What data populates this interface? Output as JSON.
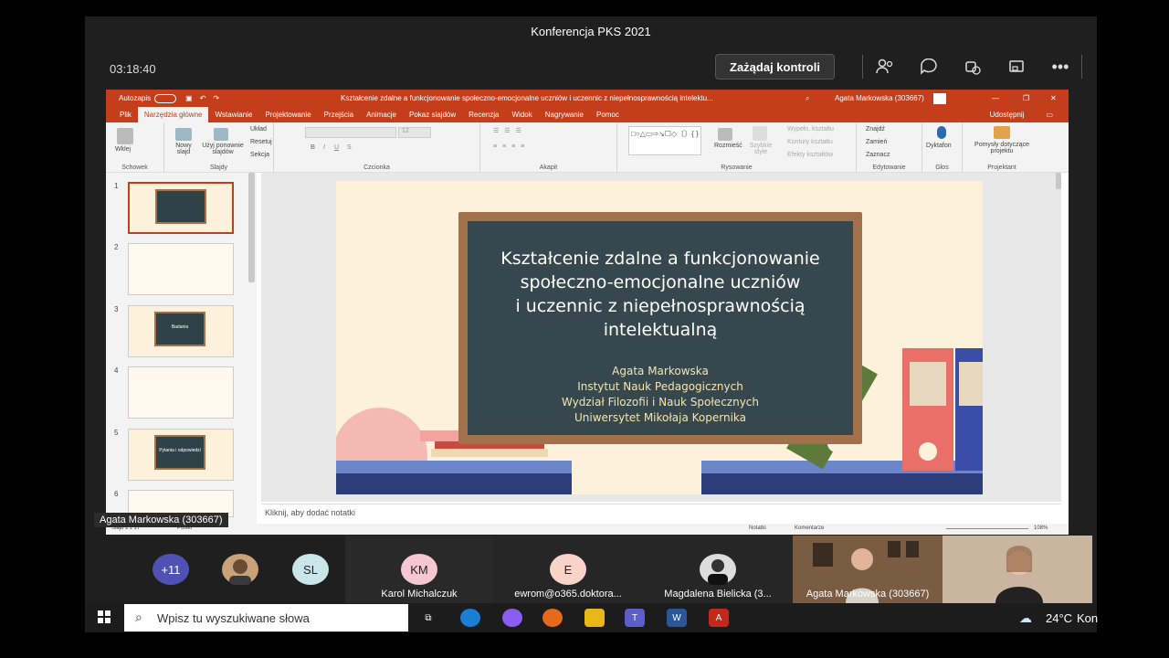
{
  "window": {
    "title": "Konferencja PKS 2021"
  },
  "call": {
    "timer": "03:18:40",
    "request_control": "Zażądaj kontroli"
  },
  "powerpoint": {
    "autosave": "Autozapis",
    "doc_title": "Kształcenie zdalne a funkcjonowanie społeczno-emocjonalne uczniów i uczennic z niepełnosprawnością intelektu...",
    "user": "Agata Markowska (303667)",
    "tabs": [
      "Plik",
      "Narzędzia główne",
      "Wstawianie",
      "Projektowanie",
      "Przejścia",
      "Animacje",
      "Pokaz slajdów",
      "Recenzja",
      "Widok",
      "Nagrywanie",
      "Pomoc"
    ],
    "share": "Udostępnij",
    "ribbon": {
      "clipboard": {
        "paste": "Wklej",
        "label": "Schowek"
      },
      "slides": {
        "new_slide": "Nowy slajd",
        "reuse": "Użyj ponownie slajdów",
        "layout": "Układ",
        "reset": "Resetuj",
        "section": "Sekcja",
        "label": "Slajdy"
      },
      "font": {
        "size": "12",
        "label": "Czcionka"
      },
      "paragraph": {
        "label": "Akapit"
      },
      "drawing": {
        "arrange": "Rozmieść",
        "quick_styles": "Szybkie style",
        "fill": "Wypełn. kształtu",
        "outline": "Kontury kształtu",
        "effects": "Efekty kształtów",
        "label": "Rysowanie"
      },
      "editing": {
        "find": "Znajdź",
        "replace": "Zamień",
        "select": "Zaznacz",
        "label": "Edytowanie"
      },
      "voice": {
        "dictate": "Dyktafon",
        "label": "Głos"
      },
      "designer": {
        "ideas": "Pomysły dotyczące projektu",
        "label": "Projektant"
      }
    },
    "thumbnails": [
      {
        "num": "1",
        "text": ""
      },
      {
        "num": "2",
        "text": ""
      },
      {
        "num": "3",
        "text": "Badania"
      },
      {
        "num": "4",
        "text": ""
      },
      {
        "num": "5",
        "text": "Pytania i odpowiedzi"
      },
      {
        "num": "6",
        "text": ""
      }
    ],
    "slide": {
      "title_lines": [
        "Kształcenie zdalne a funkcjonowanie",
        "społeczno-emocjonalne uczniów",
        "i uczennic z niepełnosprawnością",
        "intelektualną"
      ],
      "author_lines": [
        "Agata Markowska",
        "Instytut Nauk Pedagogicznych",
        "Wydział Filozofii i Nauk Społecznych",
        "Uniwersytet Mikołaja Kopernika"
      ]
    },
    "notes_placeholder": "Kliknij, aby dodać notatki",
    "status": {
      "slide": "Slajd 1 z 17",
      "language": "Polski",
      "notes": "Notatki",
      "comments": "Komentarze",
      "zoom": "108%"
    }
  },
  "presenter_chip": "Agata Markowska (303667)",
  "participants": [
    {
      "initials": "+11",
      "name": ""
    },
    {
      "initials": "",
      "name": ""
    },
    {
      "initials": "SL",
      "name": ""
    },
    {
      "initials": "KM",
      "name": "Karol Michalczuk"
    },
    {
      "initials": "E",
      "name": "ewrom@o365.doktora..."
    },
    {
      "initials": "",
      "name": "Magdalena Bielicka (3..."
    },
    {
      "initials": "",
      "name": "Agata Markowska (303667)"
    }
  ],
  "taskbar": {
    "search_placeholder": "Wpisz tu wyszukiwane słowa",
    "weather": "24°C",
    "tray_text": "Kon"
  },
  "colors": {
    "accent": "#c43e1c",
    "teams_bg": "#1f1f1f",
    "chalkboard": "#36474d",
    "slide_bg": "#fdf1dc"
  }
}
